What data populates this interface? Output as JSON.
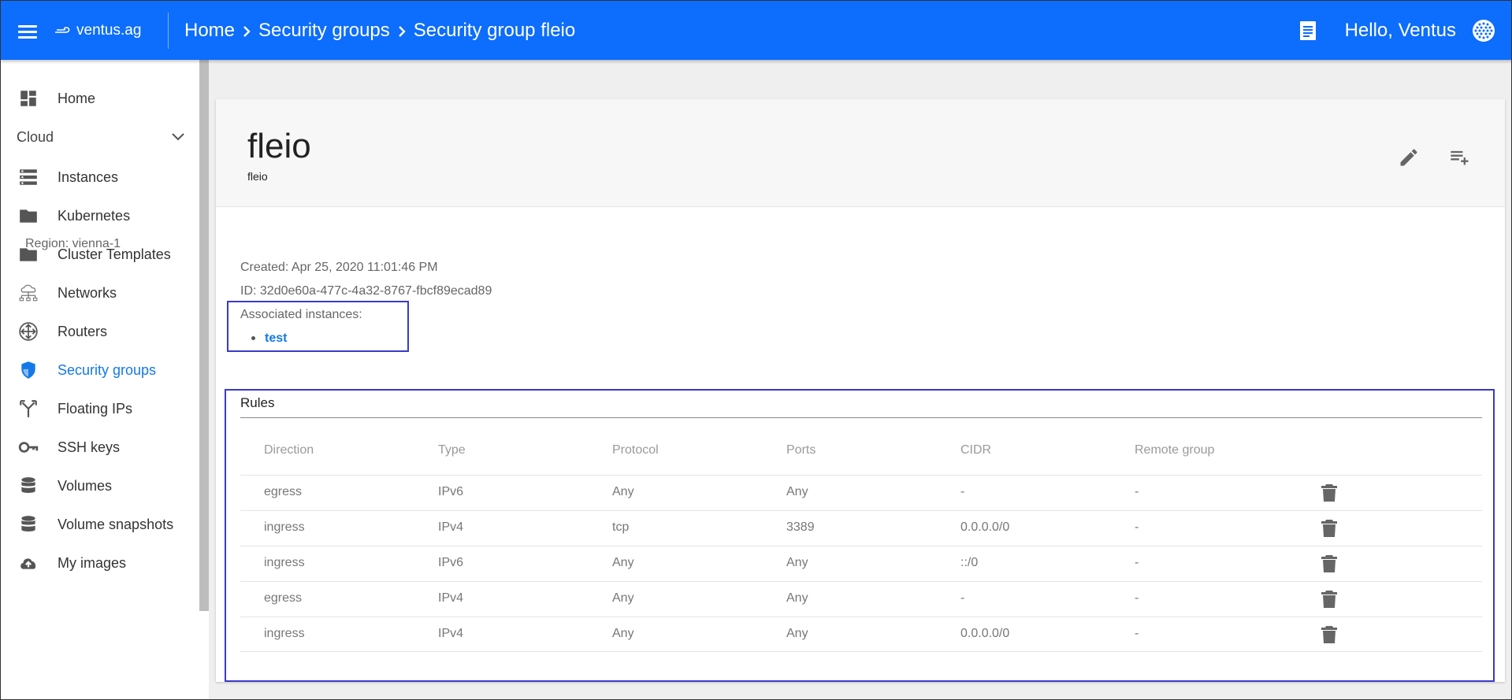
{
  "topbar": {
    "logo_text": "ventus.ag",
    "breadcrumbs": [
      "Home",
      "Security groups",
      "Security group fleio"
    ],
    "greeting": "Hello, Ventus"
  },
  "sidebar": {
    "items": [
      {
        "label": "Home",
        "icon": "dashboard-icon"
      },
      {
        "label": "Cloud",
        "icon": "chevron-down-icon"
      },
      {
        "label": "Instances",
        "icon": "server-list-icon"
      },
      {
        "label": "Kubernetes",
        "icon": "folder-icon"
      },
      {
        "label": "Cluster Templates",
        "icon": "folder-icon"
      },
      {
        "label": "Networks",
        "icon": "cloud-network-icon"
      },
      {
        "label": "Routers",
        "icon": "router-icon"
      },
      {
        "label": "Security groups",
        "icon": "shield-icon"
      },
      {
        "label": "Floating IPs",
        "icon": "fork-icon"
      },
      {
        "label": "SSH keys",
        "icon": "key-icon"
      },
      {
        "label": "Volumes",
        "icon": "database-icon"
      },
      {
        "label": "Volume snapshots",
        "icon": "database-icon"
      },
      {
        "label": "My images",
        "icon": "cloud-upload-icon"
      }
    ],
    "active_index": 7,
    "accent_color": "#1479e6"
  },
  "detail": {
    "title": "fleio",
    "subtitle": "fleio",
    "region": "Region: vienna-1",
    "created": "Created: Apr 25, 2020 11:01:46 PM",
    "id": "ID: 32d0e60a-477c-4a32-8767-fbcf89ecad89",
    "associated_label": "Associated instances:",
    "associated_instances": [
      "test"
    ]
  },
  "rules": {
    "title": "Rules",
    "columns": [
      "Direction",
      "Type",
      "Protocol",
      "Ports",
      "CIDR",
      "Remote group"
    ],
    "rows": [
      [
        "egress",
        "IPv6",
        "Any",
        "Any",
        "-",
        "-"
      ],
      [
        "ingress",
        "IPv4",
        "tcp",
        "3389",
        "0.0.0.0/0",
        "-"
      ],
      [
        "ingress",
        "IPv6",
        "Any",
        "Any",
        "::/0",
        "-"
      ],
      [
        "egress",
        "IPv4",
        "Any",
        "Any",
        "-",
        "-"
      ],
      [
        "ingress",
        "IPv4",
        "Any",
        "Any",
        "0.0.0.0/0",
        "-"
      ]
    ]
  },
  "colors": {
    "topbar": "#0d6dfc",
    "highlight_box": "#3a3ac8"
  }
}
